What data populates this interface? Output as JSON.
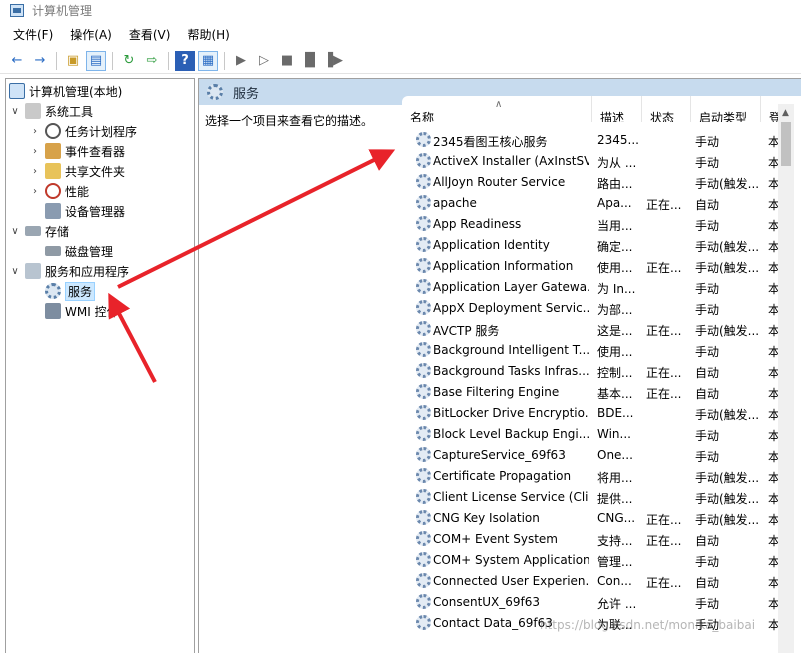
{
  "window": {
    "title": "计算机管理"
  },
  "menu": [
    "文件(F)",
    "操作(A)",
    "查看(V)",
    "帮助(H)"
  ],
  "tree": {
    "root": "计算机管理(本地)",
    "system_tools": "系统工具",
    "task_scheduler": "任务计划程序",
    "event_viewer": "事件查看器",
    "shared_folders": "共享文件夹",
    "performance": "性能",
    "device_manager": "设备管理器",
    "storage": "存储",
    "disk_management": "磁盘管理",
    "services_apps": "服务和应用程序",
    "services": "服务",
    "wmi": "WMI 控件"
  },
  "pane": {
    "title": "服务",
    "description": "选择一个项目来查看它的描述。"
  },
  "columns": [
    "名称",
    "描述",
    "状态",
    "启动类型",
    "登"
  ],
  "services": [
    {
      "name": "2345看图王核心服务",
      "desc": "2345...",
      "status": "",
      "startup": "手动",
      "logon": "本"
    },
    {
      "name": "ActiveX Installer (AxInstSV)",
      "desc": "为从 ...",
      "status": "",
      "startup": "手动",
      "logon": "本"
    },
    {
      "name": "AllJoyn Router Service",
      "desc": "路由...",
      "status": "",
      "startup": "手动(触发...",
      "logon": "本"
    },
    {
      "name": "apache",
      "desc": "Apa...",
      "status": "正在...",
      "startup": "自动",
      "logon": "本"
    },
    {
      "name": "App Readiness",
      "desc": "当用...",
      "status": "",
      "startup": "手动",
      "logon": "本"
    },
    {
      "name": "Application Identity",
      "desc": "确定...",
      "status": "",
      "startup": "手动(触发...",
      "logon": "本"
    },
    {
      "name": "Application Information",
      "desc": "使用...",
      "status": "正在...",
      "startup": "手动(触发...",
      "logon": "本"
    },
    {
      "name": "Application Layer Gatewa...",
      "desc": "为 In...",
      "status": "",
      "startup": "手动",
      "logon": "本"
    },
    {
      "name": "AppX Deployment Servic...",
      "desc": "为部...",
      "status": "",
      "startup": "手动",
      "logon": "本"
    },
    {
      "name": "AVCTP 服务",
      "desc": "这是...",
      "status": "正在...",
      "startup": "手动(触发...",
      "logon": "本"
    },
    {
      "name": "Background Intelligent T...",
      "desc": "使用...",
      "status": "",
      "startup": "手动",
      "logon": "本"
    },
    {
      "name": "Background Tasks Infras...",
      "desc": "控制...",
      "status": "正在...",
      "startup": "自动",
      "logon": "本"
    },
    {
      "name": "Base Filtering Engine",
      "desc": "基本...",
      "status": "正在...",
      "startup": "自动",
      "logon": "本"
    },
    {
      "name": "BitLocker Drive Encryptio...",
      "desc": "BDE...",
      "status": "",
      "startup": "手动(触发...",
      "logon": "本"
    },
    {
      "name": "Block Level Backup Engi...",
      "desc": "Win...",
      "status": "",
      "startup": "手动",
      "logon": "本"
    },
    {
      "name": "CaptureService_69f63",
      "desc": "One...",
      "status": "",
      "startup": "手动",
      "logon": "本"
    },
    {
      "name": "Certificate Propagation",
      "desc": "将用...",
      "status": "",
      "startup": "手动(触发...",
      "logon": "本"
    },
    {
      "name": "Client License Service (Cli...",
      "desc": "提供...",
      "status": "",
      "startup": "手动(触发...",
      "logon": "本"
    },
    {
      "name": "CNG Key Isolation",
      "desc": "CNG...",
      "status": "正在...",
      "startup": "手动(触发...",
      "logon": "本"
    },
    {
      "name": "COM+ Event System",
      "desc": "支持...",
      "status": "正在...",
      "startup": "自动",
      "logon": "本"
    },
    {
      "name": "COM+ System Application",
      "desc": "管理...",
      "status": "",
      "startup": "手动",
      "logon": "本"
    },
    {
      "name": "Connected User Experien...",
      "desc": "Con...",
      "status": "正在...",
      "startup": "自动",
      "logon": "本"
    },
    {
      "name": "ConsentUX_69f63",
      "desc": "允许 ...",
      "status": "",
      "startup": "手动",
      "logon": "本"
    },
    {
      "name": "Contact Data_69f63",
      "desc": "为联...",
      "status": "",
      "startup": "手动",
      "logon": "本"
    }
  ],
  "watermark": "https://blog.csdn.net/monika_baibai",
  "colors": {
    "header_bg": "#c7dbee",
    "selection": "#cce8ff",
    "arrow": "#e8232a"
  },
  "icons": [
    "back-icon",
    "forward-icon",
    "up-folder-icon",
    "console-tree-icon",
    "refresh-icon",
    "export-icon",
    "help-icon",
    "properties-icon",
    "play-icon",
    "play-outline-icon",
    "stop-icon",
    "pause-icon",
    "restart-icon",
    "gear-icon"
  ]
}
